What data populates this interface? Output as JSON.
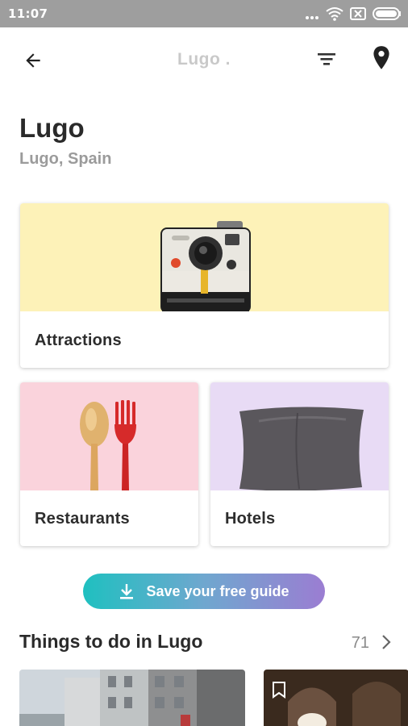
{
  "status_bar": {
    "time": "11:07"
  },
  "header": {
    "title": "Lugo ."
  },
  "page": {
    "title": "Lugo",
    "subtitle": "Lugo, Spain"
  },
  "categories": [
    {
      "label": "Attractions",
      "bg": "#fdf2b8"
    },
    {
      "label": "Restaurants",
      "bg": "#fad3dc"
    },
    {
      "label": "Hotels",
      "bg": "#e8dbf5"
    }
  ],
  "save_button": {
    "label": "Save your free guide"
  },
  "things_to_do": {
    "title": "Things to do in Lugo",
    "count": "71"
  }
}
